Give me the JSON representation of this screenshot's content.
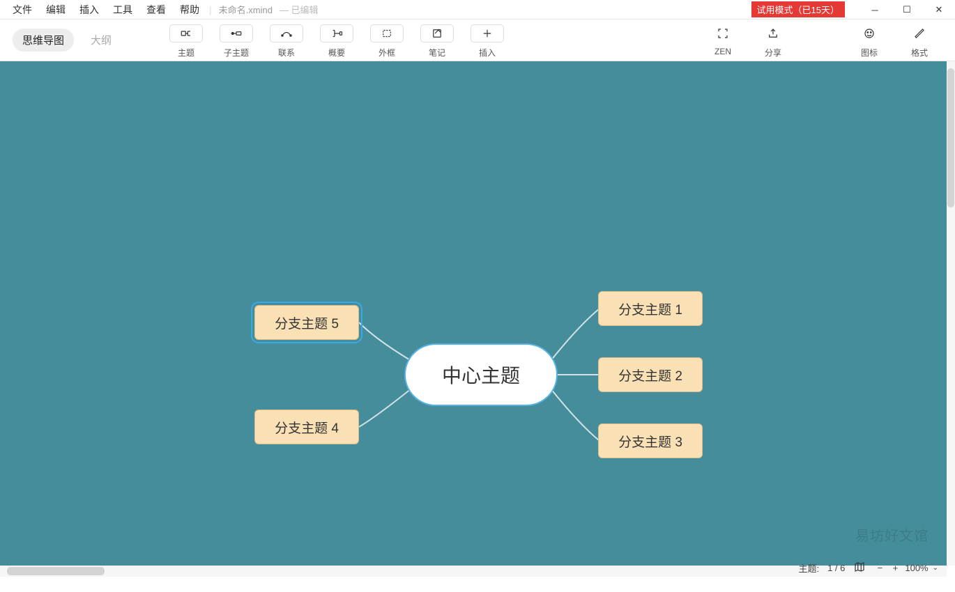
{
  "menus": {
    "file": "文件",
    "edit": "编辑",
    "insert": "插入",
    "tools": "工具",
    "view": "查看",
    "help": "帮助"
  },
  "file_title": "未命名.xmind",
  "file_status": "— 已编辑",
  "trial_text": "试用模式（已15天）",
  "view_tabs": {
    "mindmap": "思维导图",
    "outline": "大纲"
  },
  "tools": {
    "topic": "主题",
    "subtopic": "子主题",
    "relation": "联系",
    "summary": "概要",
    "boundary": "外框",
    "note": "笔记",
    "attach": "插入",
    "zen": "ZEN",
    "share": "分享",
    "marker": "图标",
    "format": "格式"
  },
  "mindmap": {
    "central": "中心主题",
    "branches": [
      {
        "label": "分支主题 1"
      },
      {
        "label": "分支主题 2"
      },
      {
        "label": "分支主题 3"
      },
      {
        "label": "分支主题 4"
      },
      {
        "label": "分支主题 5"
      }
    ]
  },
  "status": {
    "topic_label": "主题:",
    "topic_count": "1 / 6",
    "zoom": "100%"
  },
  "watermark": "易坊好文馆"
}
